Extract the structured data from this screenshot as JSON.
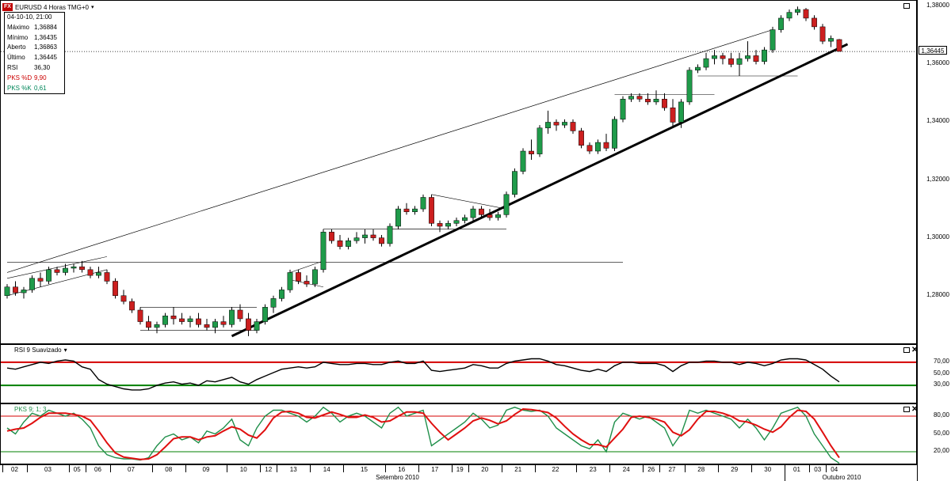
{
  "header": {
    "badge": "FX",
    "symbol_title": "EURUSD 4 Horas TMG+0",
    "caret": "▾"
  },
  "info": {
    "datetime": "04-10-10, 21:00",
    "rows": [
      {
        "label": "Máximo",
        "value": "1,36884",
        "color": "#000000"
      },
      {
        "label": "Mínimo",
        "value": "1,36435",
        "color": "#000000"
      },
      {
        "label": "Aberto",
        "value": "1,36863",
        "color": "#000000"
      },
      {
        "label": "Último",
        "value": "1,36445",
        "color": "#000000"
      },
      {
        "label": "RSI",
        "value": "36,30",
        "color": "#000000"
      },
      {
        "label": "PKS %D",
        "value": "9,90",
        "color": "#cc0000"
      },
      {
        "label": "PKS %K",
        "value": "0,61",
        "color": "#00875a"
      }
    ]
  },
  "rsi_panel": {
    "title": "RSI 9 Suavizado",
    "caret": "▾",
    "ticks": [
      "70,00",
      "50,00",
      "30,00"
    ]
  },
  "pks_panel": {
    "title": "PKS 9; 1; 3",
    "ticks": [
      "80,00",
      "50,00",
      "20,00"
    ]
  },
  "price_axis": {
    "ticks": [
      "1,38000",
      "1,36000",
      "1,34000",
      "1,32000",
      "1,30000",
      "1,28000"
    ],
    "last_price": "1,36445"
  },
  "close_glyph": "✕",
  "date_axis": {
    "days": [
      "02",
      "03",
      "05",
      "06",
      "07",
      "08",
      "09",
      "10",
      "12",
      "13",
      "14",
      "15",
      "16",
      "17",
      "19",
      "20",
      "21",
      "22",
      "23",
      "24",
      "26",
      "27",
      "28",
      "29",
      "30",
      "01",
      "03",
      "04"
    ],
    "months": [
      "Setembro 2010",
      "Outubro 2010"
    ]
  },
  "colors": {
    "up": "#1f9b4a",
    "down": "#cc1f1f",
    "rsi_line": "#000000",
    "overbought": "#d40000",
    "oversold": "#008000",
    "pks_k": "#1f8f4a",
    "pks_d": "#e01010"
  },
  "chart_data": [
    {
      "type": "candlestick",
      "title": "EURUSD 4 Horas TMG+0",
      "ylim": [
        1.2635,
        1.382
      ],
      "y_ticks": [
        1.38,
        1.36,
        1.34,
        1.32,
        1.3,
        1.28
      ],
      "last_price": 1.36445,
      "grid": false,
      "x": [
        "02",
        "02",
        "02",
        "03",
        "03",
        "03",
        "03",
        "03",
        "05",
        "05",
        "06",
        "06",
        "06",
        "07",
        "07",
        "07",
        "07",
        "07",
        "08",
        "08",
        "08",
        "08",
        "09",
        "09",
        "09",
        "09",
        "09",
        "10",
        "10",
        "10",
        "10",
        "12",
        "12",
        "13",
        "13",
        "13",
        "13",
        "14",
        "14",
        "14",
        "14",
        "15",
        "15",
        "15",
        "15",
        "15",
        "16",
        "16",
        "16",
        "16",
        "17",
        "17",
        "17",
        "17",
        "19",
        "19",
        "20",
        "20",
        "20",
        "20",
        "21",
        "21",
        "21",
        "21",
        "22",
        "22",
        "22",
        "22",
        "22",
        "23",
        "23",
        "23",
        "23",
        "24",
        "24",
        "24",
        "24",
        "26",
        "26",
        "27",
        "27",
        "27",
        "28",
        "28",
        "28",
        "28",
        "29",
        "29",
        "29",
        "29",
        "30",
        "30",
        "30",
        "30",
        "01",
        "01",
        "01",
        "03",
        "03",
        "04",
        "04"
      ],
      "ohlc": [
        [
          1.28,
          1.284,
          1.279,
          1.283
        ],
        [
          1.283,
          1.285,
          1.28,
          1.281
        ],
        [
          1.281,
          1.283,
          1.279,
          1.282
        ],
        [
          1.282,
          1.287,
          1.281,
          1.286
        ],
        [
          1.286,
          1.288,
          1.283,
          1.285
        ],
        [
          1.285,
          1.29,
          1.284,
          1.289
        ],
        [
          1.289,
          1.29,
          1.287,
          1.288
        ],
        [
          1.288,
          1.291,
          1.287,
          1.2895
        ],
        [
          1.2895,
          1.291,
          1.288,
          1.29
        ],
        [
          1.29,
          1.292,
          1.288,
          1.289
        ],
        [
          1.289,
          1.29,
          1.286,
          1.287
        ],
        [
          1.287,
          1.29,
          1.286,
          1.288
        ],
        [
          1.288,
          1.289,
          1.284,
          1.285
        ],
        [
          1.285,
          1.286,
          1.279,
          1.28
        ],
        [
          1.28,
          1.282,
          1.277,
          1.278
        ],
        [
          1.278,
          1.279,
          1.274,
          1.275
        ],
        [
          1.275,
          1.276,
          1.27,
          1.271
        ],
        [
          1.271,
          1.273,
          1.268,
          1.269
        ],
        [
          1.269,
          1.271,
          1.267,
          1.27
        ],
        [
          1.27,
          1.274,
          1.269,
          1.273
        ],
        [
          1.273,
          1.276,
          1.27,
          1.272
        ],
        [
          1.272,
          1.274,
          1.27,
          1.271
        ],
        [
          1.271,
          1.273,
          1.269,
          1.272
        ],
        [
          1.272,
          1.274,
          1.269,
          1.27
        ],
        [
          1.27,
          1.272,
          1.268,
          1.269
        ],
        [
          1.269,
          1.272,
          1.267,
          1.271
        ],
        [
          1.271,
          1.273,
          1.269,
          1.27
        ],
        [
          1.27,
          1.276,
          1.269,
          1.275
        ],
        [
          1.275,
          1.277,
          1.271,
          1.272
        ],
        [
          1.272,
          1.274,
          1.266,
          1.268
        ],
        [
          1.268,
          1.272,
          1.267,
          1.271
        ],
        [
          1.271,
          1.277,
          1.27,
          1.276
        ],
        [
          1.276,
          1.28,
          1.274,
          1.279
        ],
        [
          1.279,
          1.283,
          1.278,
          1.282
        ],
        [
          1.282,
          1.289,
          1.281,
          1.288
        ],
        [
          1.288,
          1.289,
          1.284,
          1.285
        ],
        [
          1.285,
          1.287,
          1.283,
          1.284
        ],
        [
          1.284,
          1.29,
          1.283,
          1.289
        ],
        [
          1.289,
          1.303,
          1.288,
          1.302
        ],
        [
          1.302,
          1.303,
          1.298,
          1.299
        ],
        [
          1.299,
          1.301,
          1.296,
          1.297
        ],
        [
          1.297,
          1.3,
          1.296,
          1.299
        ],
        [
          1.299,
          1.302,
          1.298,
          1.3
        ],
        [
          1.3,
          1.303,
          1.298,
          1.301
        ],
        [
          1.301,
          1.303,
          1.299,
          1.3
        ],
        [
          1.3,
          1.301,
          1.297,
          1.298
        ],
        [
          1.298,
          1.305,
          1.297,
          1.304
        ],
        [
          1.304,
          1.311,
          1.303,
          1.31
        ],
        [
          1.31,
          1.312,
          1.308,
          1.309
        ],
        [
          1.309,
          1.311,
          1.308,
          1.31
        ],
        [
          1.31,
          1.315,
          1.309,
          1.314
        ],
        [
          1.314,
          1.315,
          1.304,
          1.305
        ],
        [
          1.305,
          1.306,
          1.302,
          1.304
        ],
        [
          1.304,
          1.306,
          1.303,
          1.305
        ],
        [
          1.305,
          1.307,
          1.304,
          1.306
        ],
        [
          1.306,
          1.308,
          1.305,
          1.307
        ],
        [
          1.307,
          1.311,
          1.306,
          1.31
        ],
        [
          1.31,
          1.311,
          1.307,
          1.308
        ],
        [
          1.308,
          1.31,
          1.306,
          1.307
        ],
        [
          1.307,
          1.309,
          1.306,
          1.308
        ],
        [
          1.308,
          1.316,
          1.307,
          1.315
        ],
        [
          1.315,
          1.324,
          1.314,
          1.323
        ],
        [
          1.323,
          1.331,
          1.322,
          1.33
        ],
        [
          1.33,
          1.334,
          1.327,
          1.329
        ],
        [
          1.329,
          1.339,
          1.328,
          1.338
        ],
        [
          1.338,
          1.344,
          1.336,
          1.34
        ],
        [
          1.34,
          1.341,
          1.337,
          1.339
        ],
        [
          1.339,
          1.341,
          1.338,
          1.34
        ],
        [
          1.34,
          1.341,
          1.336,
          1.337
        ],
        [
          1.337,
          1.338,
          1.331,
          1.332
        ],
        [
          1.332,
          1.333,
          1.329,
          1.33
        ],
        [
          1.33,
          1.334,
          1.329,
          1.333
        ],
        [
          1.333,
          1.336,
          1.33,
          1.331
        ],
        [
          1.331,
          1.342,
          1.33,
          1.341
        ],
        [
          1.341,
          1.349,
          1.34,
          1.348
        ],
        [
          1.348,
          1.35,
          1.347,
          1.349
        ],
        [
          1.349,
          1.35,
          1.347,
          1.348
        ],
        [
          1.348,
          1.35,
          1.346,
          1.347
        ],
        [
          1.347,
          1.351,
          1.346,
          1.348
        ],
        [
          1.348,
          1.35,
          1.344,
          1.345
        ],
        [
          1.345,
          1.348,
          1.338,
          1.34
        ],
        [
          1.34,
          1.348,
          1.338,
          1.347
        ],
        [
          1.347,
          1.359,
          1.346,
          1.358
        ],
        [
          1.358,
          1.36,
          1.357,
          1.359
        ],
        [
          1.359,
          1.364,
          1.358,
          1.362
        ],
        [
          1.362,
          1.365,
          1.36,
          1.363
        ],
        [
          1.363,
          1.364,
          1.36,
          1.362
        ],
        [
          1.362,
          1.364,
          1.359,
          1.36
        ],
        [
          1.36,
          1.364,
          1.356,
          1.362
        ],
        [
          1.362,
          1.368,
          1.361,
          1.363
        ],
        [
          1.363,
          1.365,
          1.36,
          1.361
        ],
        [
          1.361,
          1.366,
          1.36,
          1.365
        ],
        [
          1.365,
          1.373,
          1.364,
          1.372
        ],
        [
          1.372,
          1.377,
          1.371,
          1.376
        ],
        [
          1.376,
          1.379,
          1.375,
          1.378
        ],
        [
          1.378,
          1.38,
          1.377,
          1.379
        ],
        [
          1.379,
          1.3795,
          1.375,
          1.376
        ],
        [
          1.376,
          1.377,
          1.372,
          1.373
        ],
        [
          1.373,
          1.374,
          1.367,
          1.368
        ],
        [
          1.368,
          1.37,
          1.366,
          1.369
        ],
        [
          1.3686,
          1.3688,
          1.3644,
          1.3645
        ]
      ]
    },
    {
      "type": "line",
      "title": "RSI 9 Suavizado",
      "ylim": [
        0,
        100
      ],
      "y_ticks": [
        70,
        50,
        30
      ],
      "levels": [
        70,
        30
      ],
      "series": [
        {
          "name": "RSI",
          "values": [
            60,
            58,
            62,
            66,
            70,
            68,
            72,
            74,
            72,
            62,
            58,
            40,
            32,
            28,
            24,
            22,
            22,
            24,
            30,
            34,
            36,
            32,
            34,
            30,
            38,
            36,
            40,
            44,
            36,
            32,
            40,
            46,
            52,
            58,
            60,
            62,
            60,
            62,
            70,
            68,
            66,
            66,
            68,
            68,
            66,
            66,
            70,
            72,
            68,
            68,
            72,
            56,
            54,
            56,
            58,
            60,
            66,
            64,
            60,
            60,
            68,
            72,
            74,
            76,
            76,
            72,
            66,
            64,
            60,
            56,
            54,
            58,
            54,
            64,
            70,
            70,
            68,
            68,
            68,
            64,
            54,
            64,
            70,
            70,
            72,
            72,
            70,
            70,
            66,
            70,
            68,
            64,
            68,
            74,
            76,
            76,
            74,
            66,
            58,
            46,
            36
          ]
        }
      ]
    },
    {
      "type": "line",
      "title": "PKS 9; 1; 3",
      "ylim": [
        0,
        100
      ],
      "y_ticks": [
        80,
        50,
        20
      ],
      "levels": [
        80,
        20
      ],
      "series": [
        {
          "name": "PKS %K",
          "values": [
            60,
            50,
            70,
            85,
            80,
            90,
            85,
            80,
            85,
            75,
            60,
            30,
            15,
            10,
            8,
            8,
            6,
            10,
            30,
            45,
            50,
            40,
            45,
            35,
            55,
            50,
            60,
            75,
            40,
            30,
            60,
            80,
            90,
            90,
            85,
            80,
            70,
            80,
            95,
            85,
            70,
            80,
            85,
            80,
            70,
            60,
            85,
            95,
            80,
            85,
            90,
            30,
            40,
            50,
            60,
            70,
            85,
            75,
            60,
            65,
            90,
            95,
            90,
            88,
            90,
            80,
            60,
            50,
            40,
            30,
            25,
            40,
            20,
            70,
            85,
            80,
            75,
            80,
            70,
            60,
            30,
            50,
            90,
            85,
            90,
            85,
            80,
            75,
            60,
            75,
            60,
            40,
            60,
            85,
            90,
            95,
            80,
            50,
            30,
            10,
            0.61
          ]
        },
        {
          "name": "PKS %D",
          "values": [
            55,
            58,
            60,
            68,
            78,
            85,
            85,
            85,
            83,
            80,
            73,
            55,
            35,
            18,
            11,
            9,
            7,
            8,
            15,
            28,
            42,
            45,
            45,
            40,
            45,
            47,
            55,
            62,
            58,
            48,
            43,
            57,
            77,
            87,
            88,
            85,
            78,
            77,
            82,
            87,
            83,
            78,
            78,
            82,
            78,
            70,
            72,
            80,
            87,
            87,
            85,
            68,
            53,
            40,
            50,
            60,
            72,
            77,
            73,
            67,
            72,
            83,
            92,
            91,
            89,
            86,
            77,
            63,
            50,
            40,
            32,
            32,
            28,
            43,
            58,
            78,
            80,
            78,
            75,
            70,
            53,
            47,
            57,
            75,
            88,
            88,
            85,
            80,
            72,
            70,
            65,
            58,
            53,
            62,
            78,
            90,
            88,
            75,
            53,
            30,
            9.9
          ]
        }
      ]
    }
  ]
}
